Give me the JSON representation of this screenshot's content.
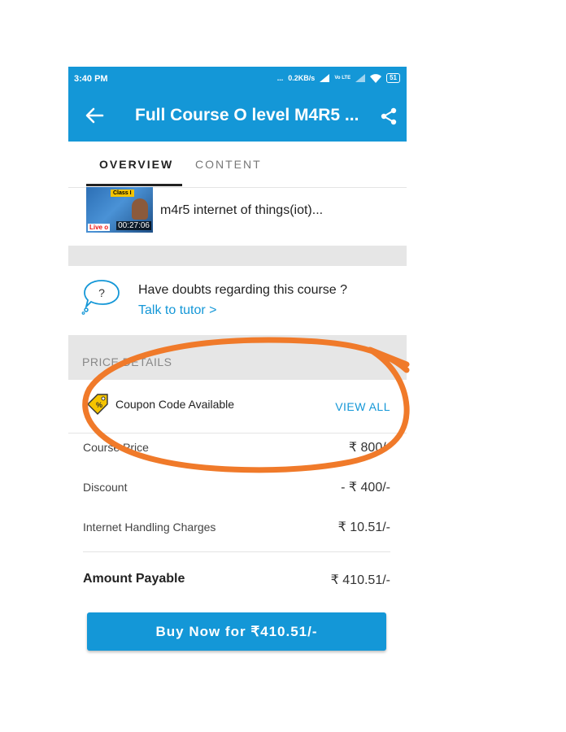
{
  "statusbar": {
    "time": "3:40 PM",
    "dots": "...",
    "speed": "0.2KB/s",
    "carrier": "Vo LTE",
    "battery": "51"
  },
  "appbar": {
    "title": "Full Course O level M4R5 ...",
    "back_icon": "arrow-left-icon",
    "share_icon": "share-icon"
  },
  "tabs": [
    {
      "label": "OVERVIEW",
      "active": true
    },
    {
      "label": "CONTENT",
      "active": false
    }
  ],
  "video": {
    "title": "m4r5 internet of things(iot)...",
    "duration": "00:27:06",
    "thumb_badge": "Class I",
    "thumb_live": "Live o"
  },
  "doubts": {
    "question": "Have doubts regarding this course ?",
    "link": "Talk to tutor  >"
  },
  "price_details": {
    "header": "PRICE DETAILS",
    "coupon_label": "Coupon Code Available",
    "view_all": "VIEW ALL",
    "rows": [
      {
        "label": "Course Price",
        "value": "₹ 800/-"
      },
      {
        "label": "Discount",
        "value": "- ₹ 400/-"
      },
      {
        "label": "Internet Handling Charges",
        "value": "₹ 10.51/-"
      }
    ],
    "total_label": "Amount Payable",
    "total_value": "₹ 410.51/-"
  },
  "buy_button": "Buy Now for ₹410.51/-",
  "colors": {
    "accent": "#1497d7",
    "annotation": "#f07a2a"
  }
}
